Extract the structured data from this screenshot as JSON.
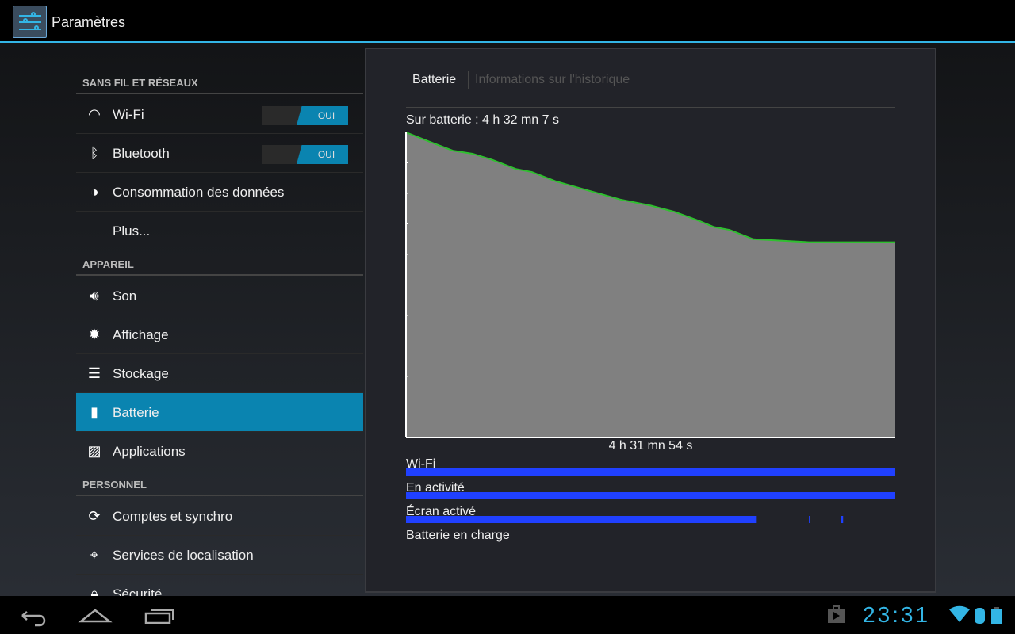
{
  "app": {
    "title": "Paramètres"
  },
  "sidebar": {
    "sections": [
      {
        "label": "SANS FIL ET RÉSEAUX"
      },
      {
        "label": "APPAREIL"
      },
      {
        "label": "PERSONNEL"
      }
    ],
    "items": [
      {
        "label": "Wi-Fi",
        "icon": "wifi-icon",
        "toggle": "OUI"
      },
      {
        "label": "Bluetooth",
        "icon": "bluetooth-icon",
        "toggle": "OUI"
      },
      {
        "label": "Consommation des données",
        "icon": "data-usage-icon"
      },
      {
        "label": "Plus..."
      },
      {
        "label": "Son",
        "icon": "speaker-icon"
      },
      {
        "label": "Affichage",
        "icon": "brightness-icon"
      },
      {
        "label": "Stockage",
        "icon": "storage-icon"
      },
      {
        "label": "Batterie",
        "icon": "battery-icon",
        "selected": true
      },
      {
        "label": "Applications",
        "icon": "applications-icon"
      },
      {
        "label": "Comptes et synchro",
        "icon": "sync-icon"
      },
      {
        "label": "Services de localisation",
        "icon": "location-icon"
      },
      {
        "label": "Sécurité",
        "icon": "lock-icon"
      }
    ]
  },
  "panel": {
    "tabs": [
      {
        "label": "Batterie",
        "active": true
      },
      {
        "label": "Informations sur l'historique"
      }
    ],
    "on_battery": "Sur batterie : 4 h 32 mn 7 s",
    "duration": "4 h 31 mn 54 s",
    "bars": [
      {
        "label": "Wi-Fi"
      },
      {
        "label": "En activité"
      },
      {
        "label": "Écran activé"
      },
      {
        "label": "Batterie en charge"
      }
    ]
  },
  "chart_data": {
    "type": "area",
    "x_unit": "minutes",
    "xlim": [
      0,
      272
    ],
    "ylim": [
      0,
      100
    ],
    "grid": false,
    "x": [
      0,
      12.8,
      26,
      37,
      48,
      61,
      70,
      83,
      101,
      119,
      136,
      149,
      163,
      171,
      180,
      193,
      224,
      272
    ],
    "y": [
      100,
      97,
      94,
      93,
      91,
      88,
      87,
      84,
      81,
      78,
      76,
      74,
      71,
      69,
      68,
      65,
      64,
      64
    ],
    "line_color": "#2fbf2f",
    "fill_color": "#808080",
    "activity": [
      {
        "label": "Wi-Fi",
        "segments": [
          [
            0,
            272
          ]
        ]
      },
      {
        "label": "En activité",
        "segments": [
          [
            0,
            272
          ]
        ]
      },
      {
        "label": "Écran activé",
        "segments": [
          [
            0,
            195
          ],
          [
            224,
            224.5
          ],
          [
            242,
            243
          ]
        ]
      },
      {
        "label": "Batterie en charge",
        "segments": []
      }
    ],
    "bar_color": "#2040ff"
  },
  "statusbar": {
    "time": "23:31",
    "icons": [
      "play-store-icon",
      "wifi-icon",
      "bluetooth-icon",
      "battery-icon"
    ]
  },
  "navbar": {
    "icons": [
      "back-icon",
      "home-icon",
      "recent-apps-icon"
    ]
  },
  "colors": {
    "accent": "#33b5e5",
    "selected": "#0a84b0"
  }
}
